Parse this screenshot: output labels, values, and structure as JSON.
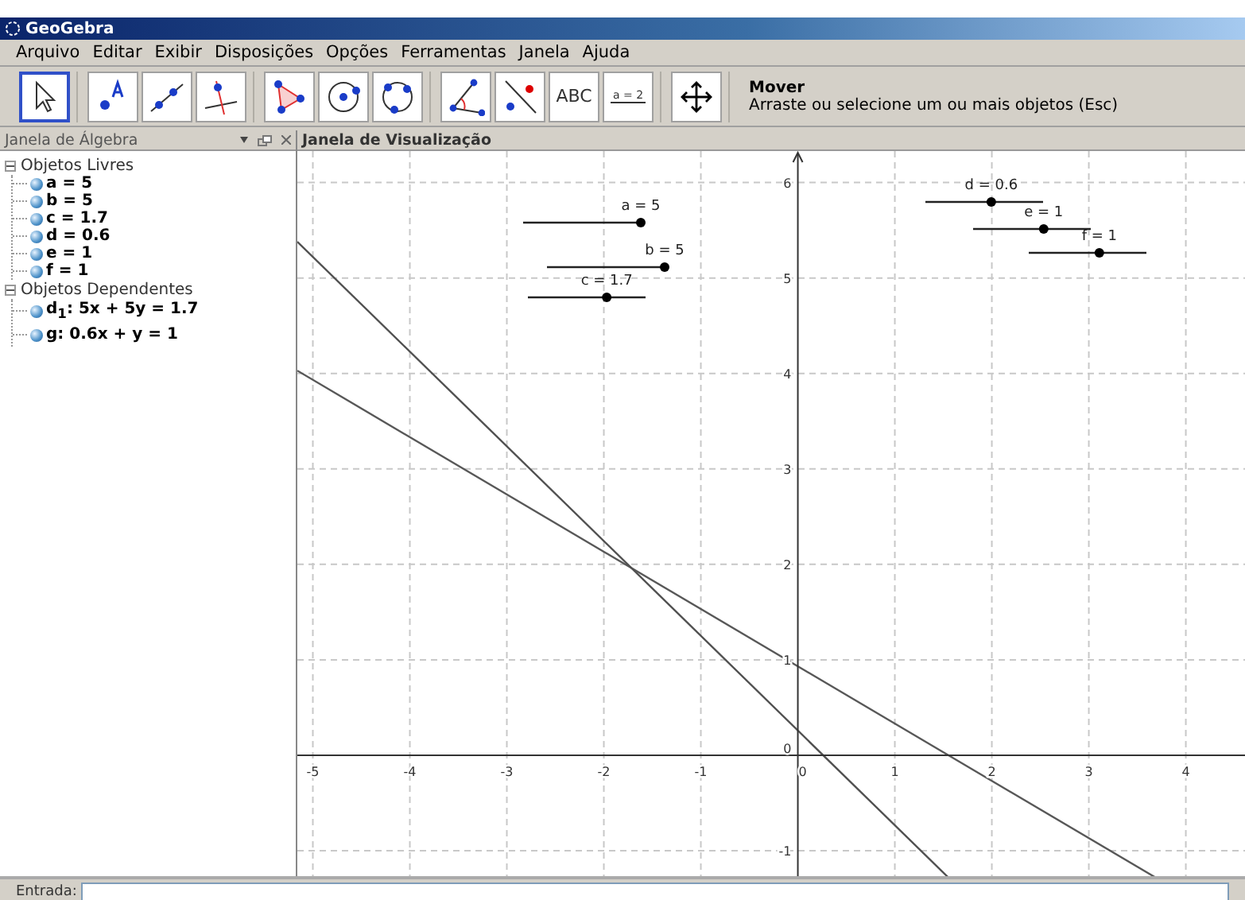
{
  "window": {
    "title": "GeoGebra"
  },
  "menu": [
    "Arquivo",
    "Editar",
    "Exibir",
    "Disposições",
    "Opções",
    "Ferramentas",
    "Janela",
    "Ajuda"
  ],
  "toolbar": {
    "tools": [
      {
        "selected": true
      },
      {
        "selected": false
      },
      {
        "selected": false
      },
      {
        "selected": false
      },
      {
        "selected": false
      },
      {
        "selected": false
      },
      {
        "selected": false
      },
      {
        "selected": false
      },
      {
        "selected": false
      },
      {
        "selected": false,
        "label": "ABC"
      },
      {
        "selected": false,
        "label": "a = 2"
      },
      {
        "selected": false
      }
    ],
    "help": {
      "title": "Mover",
      "description": "Arraste ou selecione um ou mais objetos (Esc)"
    }
  },
  "algebra_view": {
    "title": "Janela de Álgebra",
    "tree": [
      {
        "label": "Objetos Livres",
        "expanded": true,
        "children": [
          {
            "label": "a = 5"
          },
          {
            "label": "b = 5"
          },
          {
            "label": "c = 1.7"
          },
          {
            "label": "d = 0.6"
          },
          {
            "label": "e = 1"
          },
          {
            "label": "f = 1"
          }
        ]
      },
      {
        "label": "Objetos Dependentes",
        "expanded": true,
        "children": [
          {
            "label": "d$_{1}$: 5x + 5y = 1.7"
          },
          {
            "label": "g: 0.6x + y = 1"
          }
        ]
      }
    ]
  },
  "graphics_view": {
    "title": "Janela de Visualização",
    "sliders": [
      {
        "label": "a = 5",
        "level": 1
      },
      {
        "label": "b = 5",
        "level": 1
      },
      {
        "label": "c = 1.7",
        "level": 0.67
      },
      {
        "label": "d = 0.6",
        "level": 0.56
      },
      {
        "label": "e = 1",
        "level": 0.6
      },
      {
        "label": "f = 1",
        "level": 0.6
      }
    ],
    "chart_data": {
      "type": "line",
      "grid": true,
      "x": [
        -5.16,
        1.57,
        3.72
      ],
      "series": [
        {
          "color": "#585858",
          "values": [
            4.03,
            -0.01,
            -1.3
          ]
        },
        {
          "color": "#505050",
          "values": [
            5.38,
            -1.3,
            null
          ]
        }
      ],
      "xlim": [
        -5.16,
        4.61
      ],
      "ylim": [
        -1.35,
        6.33
      ],
      "xticks": [
        -5,
        -4,
        -3,
        -2,
        -1,
        0,
        1,
        2,
        3,
        4
      ],
      "yticks": [
        -1,
        0,
        1,
        2,
        3,
        4,
        5,
        6
      ]
    }
  },
  "input_bar": {
    "label": "Entrada:"
  }
}
